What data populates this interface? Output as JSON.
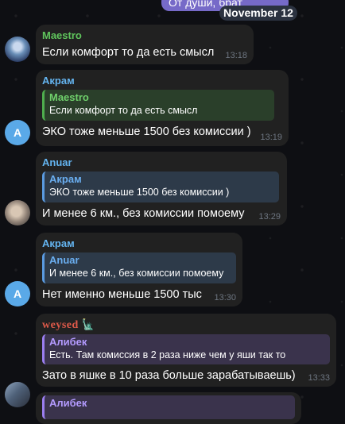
{
  "top": {
    "outgoing_text": "От души, брат",
    "date": "November 12"
  },
  "messages": [
    {
      "sender": "Maestro",
      "sender_color": "#5fc45c",
      "text": "Если комфорт то да есть смысл",
      "time": "13:18"
    },
    {
      "sender": "Акрам",
      "sender_color": "#64b4f0",
      "avatar_letter": "A",
      "reply_name": "Maestro",
      "reply_text": "Если комфорт то да есть смысл",
      "text": "ЭКО тоже меньше 1500 без комиссии )",
      "time": "13:19"
    },
    {
      "sender": "Anuar",
      "sender_color": "#64b4f0",
      "reply_name": "Акрам",
      "reply_text": "ЭКО тоже меньше 1500 без комиссии )",
      "text": "И менее 6 км., без комиссии помоему",
      "time": "13:29"
    },
    {
      "sender": "Акрам",
      "sender_color": "#64b4f0",
      "avatar_letter": "A",
      "reply_name": "Anuar",
      "reply_text": "И менее 6 км., без комиссии помоему",
      "text": "Нет именно меньше 1500 тыс",
      "time": "13:30"
    },
    {
      "sender": "weysed",
      "sender_color": "#e05a4a",
      "reply_name": "Алибек",
      "reply_text": "Есть. Там комиссия в 2 раза ниже чем у яши так то",
      "text": "Зато в яшке в 10 раза больше зарабатываешь)",
      "time": "13:33"
    },
    {
      "reply_name": "Алибек"
    }
  ]
}
